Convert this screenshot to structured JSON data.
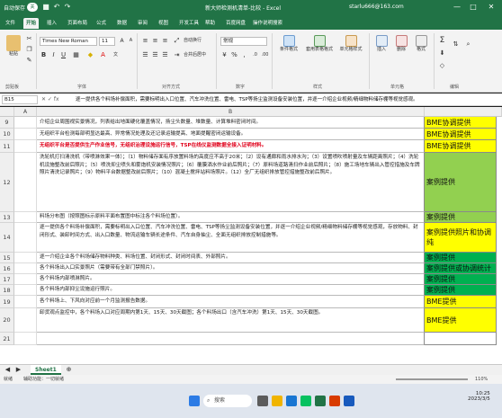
{
  "window": {
    "title": "新大师检测机清单-比较 - Excel",
    "account": "starlu666@163.com",
    "autosave_label": "自动保存",
    "autosave_state": "关",
    "controls": [
      "—",
      "□",
      "✕"
    ]
  },
  "tabs": [
    "文件",
    "开始",
    "插入",
    "页面布局",
    "公式",
    "数据",
    "审阅",
    "视图",
    "开发工具",
    "帮助",
    "百度网盘",
    "操作说明搜索"
  ],
  "active_tab": "开始",
  "ribbon": {
    "paste_label": "粘贴",
    "clipboard_label": "剪贴板",
    "font_name": "Times New Roman",
    "font_size": "11",
    "font_group_label": "字体",
    "align_group_label": "对齐方式",
    "wrap_label": "自动换行",
    "merge_label": "合并后居中",
    "number_format": "常规",
    "number_group_label": "数字",
    "cond_format_label": "条件格式",
    "table_format_label": "套用表格格式",
    "cell_style_label": "单元格样式",
    "styles_group_label": "样式",
    "insert_label": "插入",
    "delete_label": "删除",
    "format_label": "格式",
    "cells_group_label": "单元格",
    "editing_group_label": "编辑",
    "sum_icon": "Σ"
  },
  "formula_bar": {
    "name_box": "B15",
    "icons": "✕ ✓ fx",
    "content": "逐一提供各个料场补偿面积，需要标明出入口位置、汽车冲洗位置、雷电、TSP等扬尘监测设备安装位置，并逐一介绍企业视频/精细物料储存棚等视觉感观。"
  },
  "grid": {
    "column_headers": [
      "A",
      "B"
    ],
    "rows": [
      {
        "num": "9",
        "text": "介绍企业周围视实景情况，列表给出地面硬化覆盖情况，扬尘头数量、堆数量、计算堆料密闭时间。",
        "c": "BME协调提供",
        "red": false
      },
      {
        "num": "10",
        "text": "无组织平台检测每部明显达最高、异常情况处理及还记录运输提高、地面提醒密闭运输设备。",
        "c": "BME协调提供",
        "red": false
      },
      {
        "num": "11",
        "text": "无组织平台是否提供生产作业信号，无组织治理设施运行信号，TSP在线仪监测数据全接入证明材料。",
        "c": "BME协调提供",
        "red": true
      },
      {
        "num": "12",
        "text": "洗轮机打扫清洗机（带喷淋效果一体）；（1）物料储存面有序放置料场的高度应不高于20米；（2）设有通廊和雨水排水沟；（3）设置喷吹喷射量及车辆距离照片；（4）洗轮机设施整改前后照片；（5）喷洗抑尘喷头和雾炮机安装情况照片；（6）覆膜洒水作业前后照片；（7）原料场道路清扫作业前后照片；（8）施工场地车辆出入管控措施及车牌照片清洗记录照片；（9）物料平台数据整改前后照片；（10）混凝土搅拌站料场照片。（12）全厂无组织排放管控措施整改前后照片。",
        "c": "案例提供",
        "red": false
      },
      {
        "num": "13",
        "text": "料场分布图（按照图标示原料平面布置图中标注各个料场位置）。",
        "c": "案例提供",
        "red": false
      },
      {
        "num": "14",
        "text": "逐一提供各个料场补偿面积，需要标明出入口位置、汽车冲洗位置、雷电、TSP等扬尘监测设备安装位置，并逐一介绍企业视频/精细物料储存棚等视觉感观，存放物料、封闭形式、装卸时间方式、出入口数量、物流运输车辆长途条件、汽车自身抽尘、全面无组织排放控制措施等。",
        "c": "案例提供照片和协调纯",
        "red": false
      },
      {
        "num": "15",
        "text": "逐一介绍企业各个料场储存物料种类、料场位置、封闭形式、封闭时间表、外部照片。",
        "c": "案例提供",
        "red": false
      },
      {
        "num": "16",
        "text": "各个料场出入口实景照片（需要带有全部门禁照片）。",
        "c": "案例提供或协调统计",
        "red": false
      },
      {
        "num": "17",
        "text": "各个料场内部喷淋照片。",
        "c": "案例提供",
        "red": false
      },
      {
        "num": "18",
        "text": "各个料场内部抑尘设施运行照片。",
        "c": "案例提供",
        "red": false
      },
      {
        "num": "19",
        "text": "各个料场上、下风向对应前一个月监测报告数据。",
        "c": "BME提供",
        "red": false
      },
      {
        "num": "20",
        "text": "卸货观点监控中，各个料场入口对应周期内第1天、15天、30天截图；各个料场出口（含汽车冲洗）第1天、15天、30天截图。",
        "c": "BME提供",
        "red": false
      },
      {
        "num": "21",
        "text": "",
        "c": "",
        "red": false
      }
    ]
  },
  "sheet_tab": "Sheet1",
  "status": {
    "ready": "就绪",
    "accessibility": "辅助功能：一切就绪",
    "zoom": "110%"
  },
  "taskbar": {
    "search_placeholder": "搜索",
    "time": "10:25",
    "date": "2023/3/5"
  },
  "colors": {
    "excel_green": "#217346",
    "yellow": "#ffff00",
    "light_green": "#92d050",
    "green_fill": "#00b050",
    "red_text": "#e0001a"
  }
}
